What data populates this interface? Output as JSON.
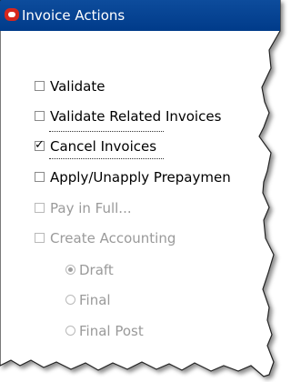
{
  "window": {
    "title": "Invoice Actions",
    "logo_icon": "oracle-logo-icon",
    "titlebar_color": "#003b8a"
  },
  "options": [
    {
      "label": "Validate",
      "mnemonic": "V",
      "checked": false,
      "enabled": true
    },
    {
      "label": "Validate Related Invoices",
      "mnemonic": "R",
      "checked": false,
      "enabled": true
    },
    {
      "label": "Cancel Invoices",
      "checked": true,
      "enabled": true,
      "focused": true
    },
    {
      "label": "Apply/Unapply Prepaymen",
      "mnemonic": "U",
      "checked": false,
      "enabled": true
    },
    {
      "label": "Pay in Full...",
      "mnemonic": "P",
      "checked": false,
      "enabled": false
    },
    {
      "label": "Create Accounting",
      "mnemonic": "t",
      "checked": false,
      "enabled": false
    }
  ],
  "accounting_modes": [
    {
      "label": "Draft",
      "mnemonic": "D",
      "selected": true,
      "enabled": false
    },
    {
      "label": "Final",
      "mnemonic": "a",
      "selected": false,
      "enabled": false
    },
    {
      "label": "Final Post",
      "mnemonic": "o",
      "selected": false,
      "enabled": false
    }
  ]
}
